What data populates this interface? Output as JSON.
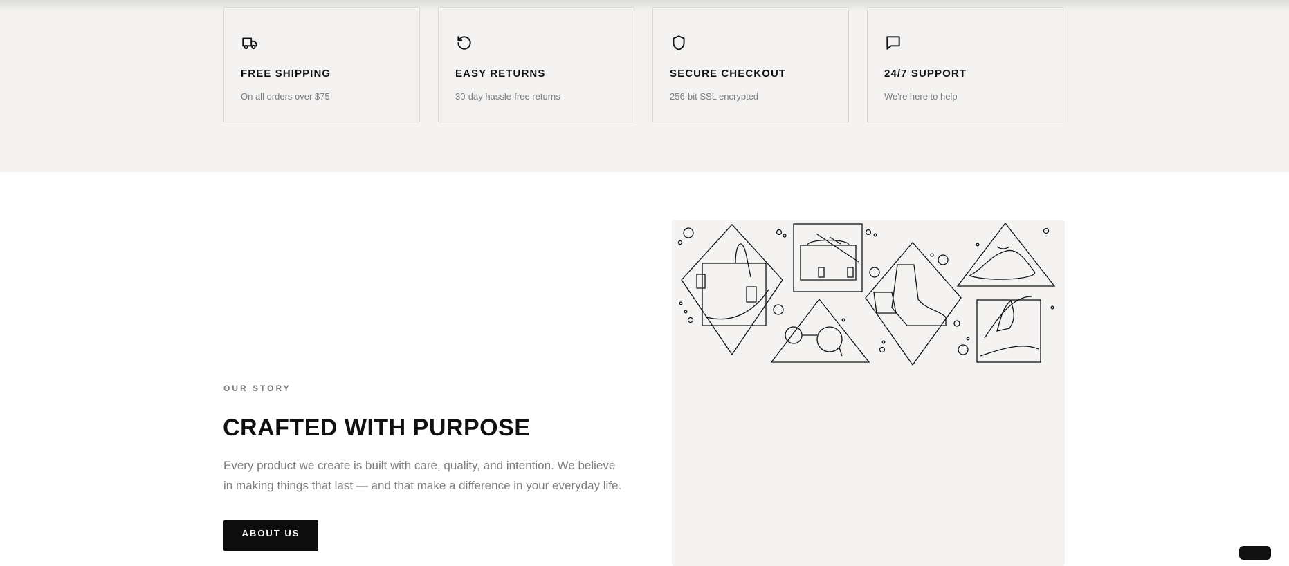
{
  "features": [
    {
      "icon": "truck-icon",
      "title": "FREE SHIPPING",
      "subtitle": "On all orders over $75"
    },
    {
      "icon": "rotate-ccw-icon",
      "title": "EASY RETURNS",
      "subtitle": "30-day hassle-free returns"
    },
    {
      "icon": "shield-icon",
      "title": "SECURE CHECKOUT",
      "subtitle": "256-bit SSL encrypted"
    },
    {
      "icon": "message-square-icon",
      "title": "24/7 SUPPORT",
      "subtitle": "We're here to help"
    }
  ],
  "story": {
    "label": "OUR STORY",
    "title": "CRAFTED WITH PURPOSE",
    "body": "Every product we create is built with care, quality, and intention. We believe in making things that last — and that make a difference in your everyday life.",
    "button_label": "ABOUT US"
  },
  "colors": {
    "section_bg": "#f4f3f1",
    "button_bg": "#0d0d0d",
    "muted_text": "#7c7c7c"
  }
}
